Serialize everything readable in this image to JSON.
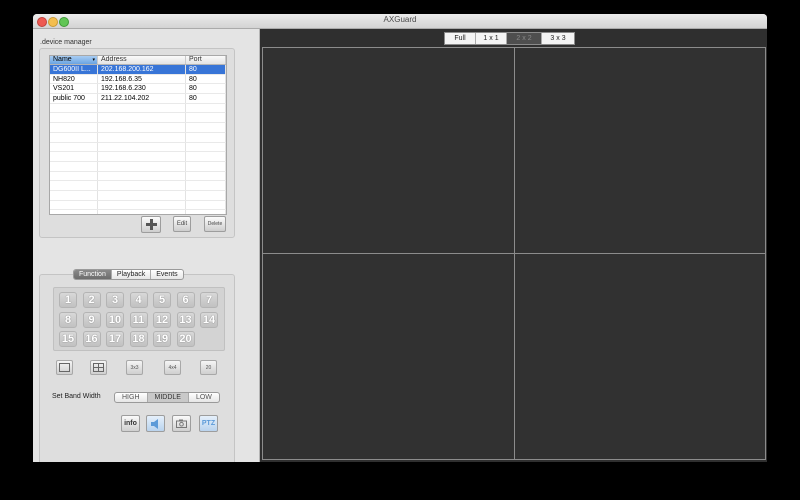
{
  "window": {
    "title": "AXGuard"
  },
  "device_manager": {
    "label": ".device manager",
    "columns": [
      "Name",
      "Address",
      "Port"
    ],
    "rows": [
      {
        "name": "DG600II L...",
        "address": "202.168.200.162",
        "port": "80"
      },
      {
        "name": "NH820",
        "address": "192.168.6.35",
        "port": "80"
      },
      {
        "name": "VS201",
        "address": "192.168.6.230",
        "port": "80"
      },
      {
        "name": "public 700",
        "address": "211.22.104.202",
        "port": "80"
      }
    ],
    "empty_rows": 12,
    "buttons": {
      "edit": "Edit",
      "delete": "Delete"
    }
  },
  "function_panel": {
    "tabs": [
      "Function",
      "Playback",
      "Events"
    ],
    "active_tab": "Function",
    "channels": [
      "1",
      "2",
      "3",
      "4",
      "5",
      "6",
      "7",
      "8",
      "9",
      "10",
      "11",
      "12",
      "13",
      "14",
      "15",
      "16",
      "17",
      "18",
      "19",
      "20"
    ],
    "layout_buttons": [
      "1x1",
      "2x2",
      "3x3",
      "4x4",
      "20"
    ],
    "band_width": {
      "label": "Set Band Width",
      "options": [
        "HIGH",
        "MIDDLE",
        "LOW"
      ],
      "selected": "MIDDLE"
    },
    "tools": {
      "info": "info",
      "ptz": "PTZ"
    }
  },
  "video": {
    "view_modes": [
      "Full",
      "1 x 1",
      "2 x 2",
      "3 x 3"
    ],
    "active_view": "2 x 2"
  },
  "colors": {
    "selection": "#3875d7",
    "video_bg": "#2f2f2f",
    "pane_border": "#8c8c8c"
  }
}
